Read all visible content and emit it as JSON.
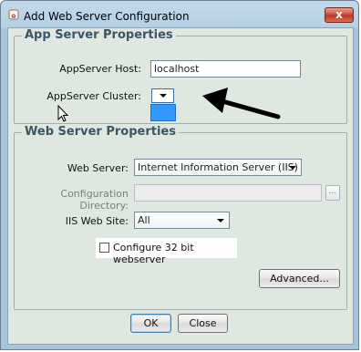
{
  "window": {
    "title": "Add Web Server Configuration",
    "close_label": "x"
  },
  "app_server": {
    "group_title": "App Server Properties",
    "host_label": "AppServer Host:",
    "host_value": "localhost",
    "cluster_label": "AppServer Cluster:",
    "cluster_value": ""
  },
  "web_server": {
    "group_title": "Web Server Properties",
    "web_server_label": "Web Server:",
    "web_server_value": "Internet Information Server (IIS)",
    "config_dir_label": "Configuration Directory:",
    "config_dir_value": "",
    "browse_label": "...",
    "iis_site_label": "IIS Web Site:",
    "iis_site_value": "All",
    "checkbox_label": "Configure 32 bit webserver",
    "checkbox_checked": false,
    "advanced_label": "Advanced..."
  },
  "buttons": {
    "ok_label": "OK",
    "close_label": "Close"
  },
  "colors": {
    "selection": "#3399ff",
    "annotation_arrow": "#000000"
  },
  "icons": [
    "java-app-icon",
    "close-icon",
    "chevron-down-icon",
    "pointer-cursor-icon",
    "annotation-arrow-icon"
  ]
}
